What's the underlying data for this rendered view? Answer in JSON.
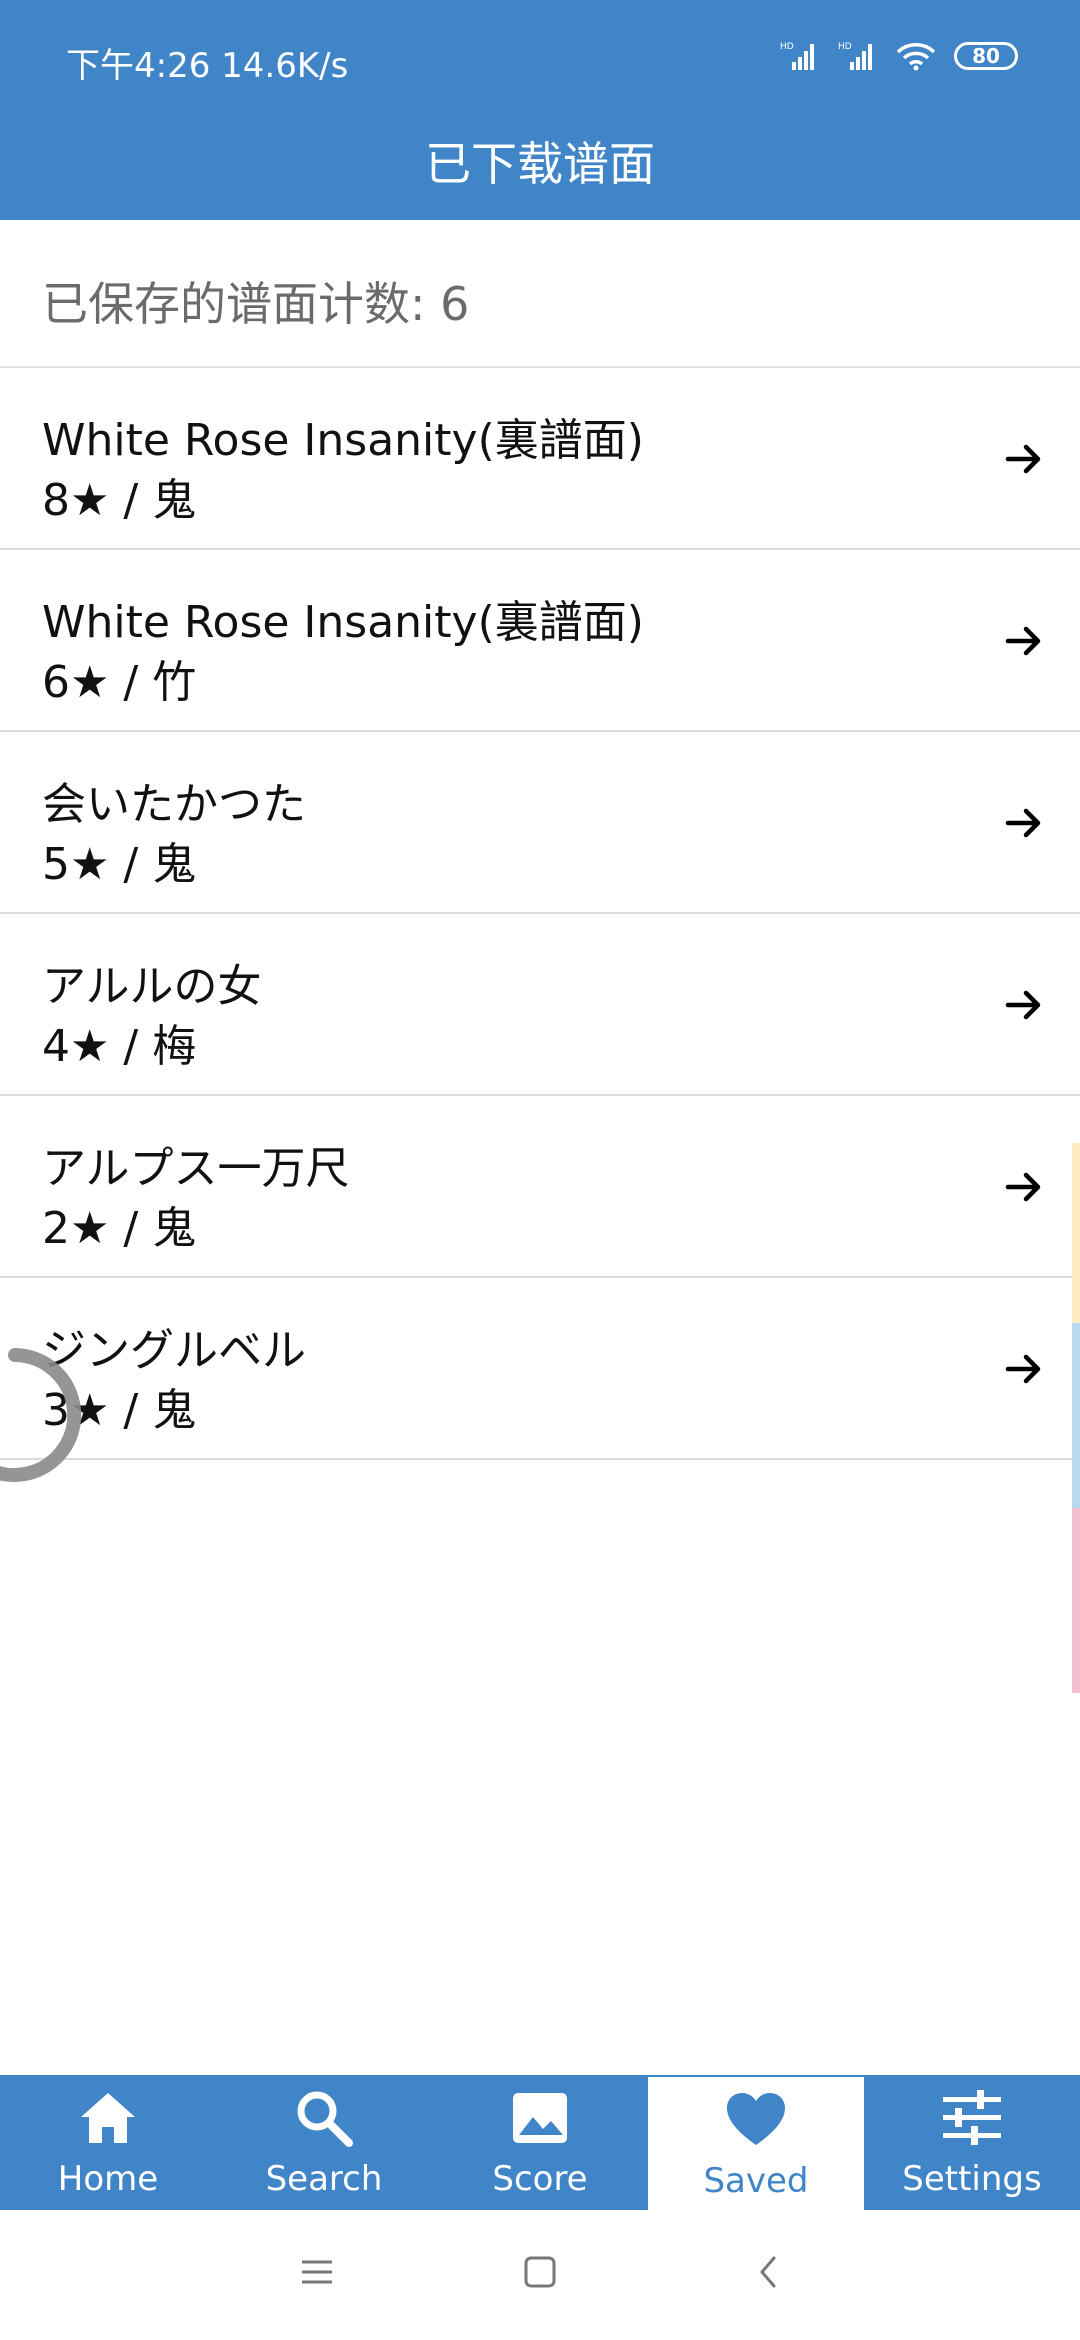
{
  "status_bar": {
    "time_speed": "下午4:26 14.6K/s",
    "signal1_label": "HD",
    "signal2_label": "HD",
    "battery": "80"
  },
  "header": {
    "title": "已下载谱面"
  },
  "summary": {
    "count_text": "已保存的谱面计数: 6"
  },
  "songs": [
    {
      "title": "White Rose Insanity(裏譜面)",
      "detail": "8★ / 鬼"
    },
    {
      "title": "White Rose Insanity(裏譜面)",
      "detail": "6★ / 竹"
    },
    {
      "title": "会いたかつた",
      "detail": "5★ / 鬼"
    },
    {
      "title": "アルルの女",
      "detail": "4★ / 梅"
    },
    {
      "title": "アルプス一万尺",
      "detail": "2★ / 鬼"
    },
    {
      "title": "ジングルベル",
      "detail": "3★ / 鬼"
    }
  ],
  "bottom_nav": {
    "items": [
      {
        "label": "Home",
        "icon": "home-icon"
      },
      {
        "label": "Search",
        "icon": "search-icon"
      },
      {
        "label": "Score",
        "icon": "image-icon"
      },
      {
        "label": "Saved",
        "icon": "heart-icon",
        "active": true
      },
      {
        "label": "Settings",
        "icon": "sliders-icon"
      }
    ]
  },
  "colors": {
    "primary": "#3f85c8",
    "strip_yellow": "#fdebc4",
    "strip_blue": "#b9d9f0",
    "strip_pink": "#f1bfd0"
  }
}
